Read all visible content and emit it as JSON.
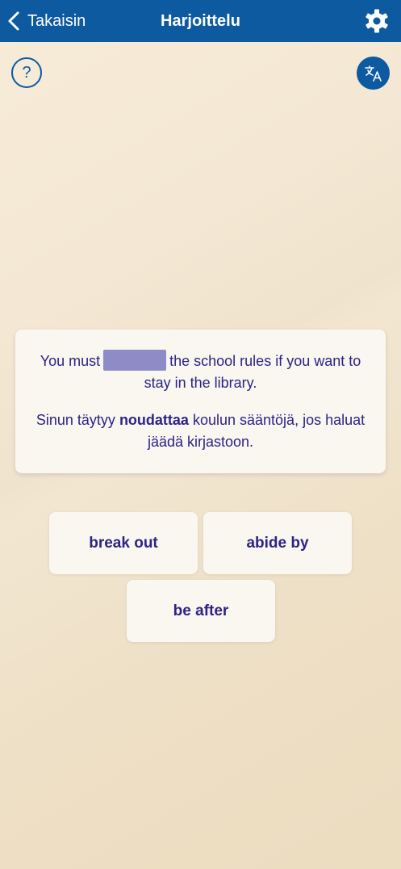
{
  "header": {
    "back_label": "Takaisin",
    "title": "Harjoittelu"
  },
  "help": {
    "label": "?"
  },
  "card": {
    "en_before": "You must",
    "en_after": "the school rules if you want to stay in the library.",
    "fi_before": "Sinun täytyy",
    "fi_highlight": "noudattaa",
    "fi_after": "koulun sääntöjä, jos haluat jäädä kirjastoon."
  },
  "answers": [
    "break out",
    "abide by",
    "be after"
  ],
  "colors": {
    "header_bg": "#0d5aa0",
    "text": "#2b2485",
    "blank": "#8e8cc6",
    "card_bg": "#faf6f0"
  },
  "icons": {
    "back": "chevron-left-icon",
    "settings": "gear-icon",
    "translate": "translate-icon"
  }
}
